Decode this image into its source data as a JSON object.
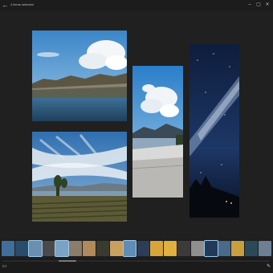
{
  "window": {
    "title": "4 items selected",
    "back_glyph": "←",
    "minimize_glyph": "–",
    "maximize_glyph": "▢",
    "close_glyph": "✕"
  },
  "collage": {
    "photos": [
      {
        "name": "lake-clouds-photo",
        "subject": "lake with cliffs and clouds"
      },
      {
        "name": "sunset-vineyard-photo",
        "subject": "vineyard under cloudy sky"
      },
      {
        "name": "balcony-sky-photo",
        "subject": "balcony view with clouds"
      },
      {
        "name": "milky-way-photo",
        "subject": "night sky milky way"
      }
    ]
  },
  "filmstrip": {
    "thumbs": [
      {
        "color": "#3f6f9a",
        "selected": false
      },
      {
        "color": "#294c6a",
        "selected": false
      },
      {
        "color": "#6a8fb0",
        "selected": true
      },
      {
        "color": "#4a4a4a",
        "selected": false
      },
      {
        "color": "#7aa3c4",
        "selected": true
      },
      {
        "color": "#8a7d6a",
        "selected": false
      },
      {
        "color": "#b08a5a",
        "selected": false
      },
      {
        "color": "#3a3a30",
        "selected": false
      },
      {
        "color": "#c8a060",
        "selected": false
      },
      {
        "color": "#5f8db5",
        "selected": true
      },
      {
        "color": "#2b3d58",
        "selected": false
      },
      {
        "color": "#d7a53a",
        "selected": false
      },
      {
        "color": "#e0b040",
        "selected": false
      },
      {
        "color": "#3b3b3b",
        "selected": false
      },
      {
        "color": "#8f8f8f",
        "selected": false
      },
      {
        "color": "#23395a",
        "selected": true
      },
      {
        "color": "#4a6a8a",
        "selected": false
      },
      {
        "color": "#c8a040",
        "selected": false
      },
      {
        "color": "#2a4a5a",
        "selected": false
      },
      {
        "color": "#6c7f95",
        "selected": false
      }
    ]
  },
  "bottombar": {
    "left_icon": "photo-icon",
    "right_icon": "edit-icon",
    "left_glyph": "▭",
    "right_glyph": "✎"
  },
  "colors": {
    "background": "#202020",
    "accent": "#9ccbea"
  }
}
